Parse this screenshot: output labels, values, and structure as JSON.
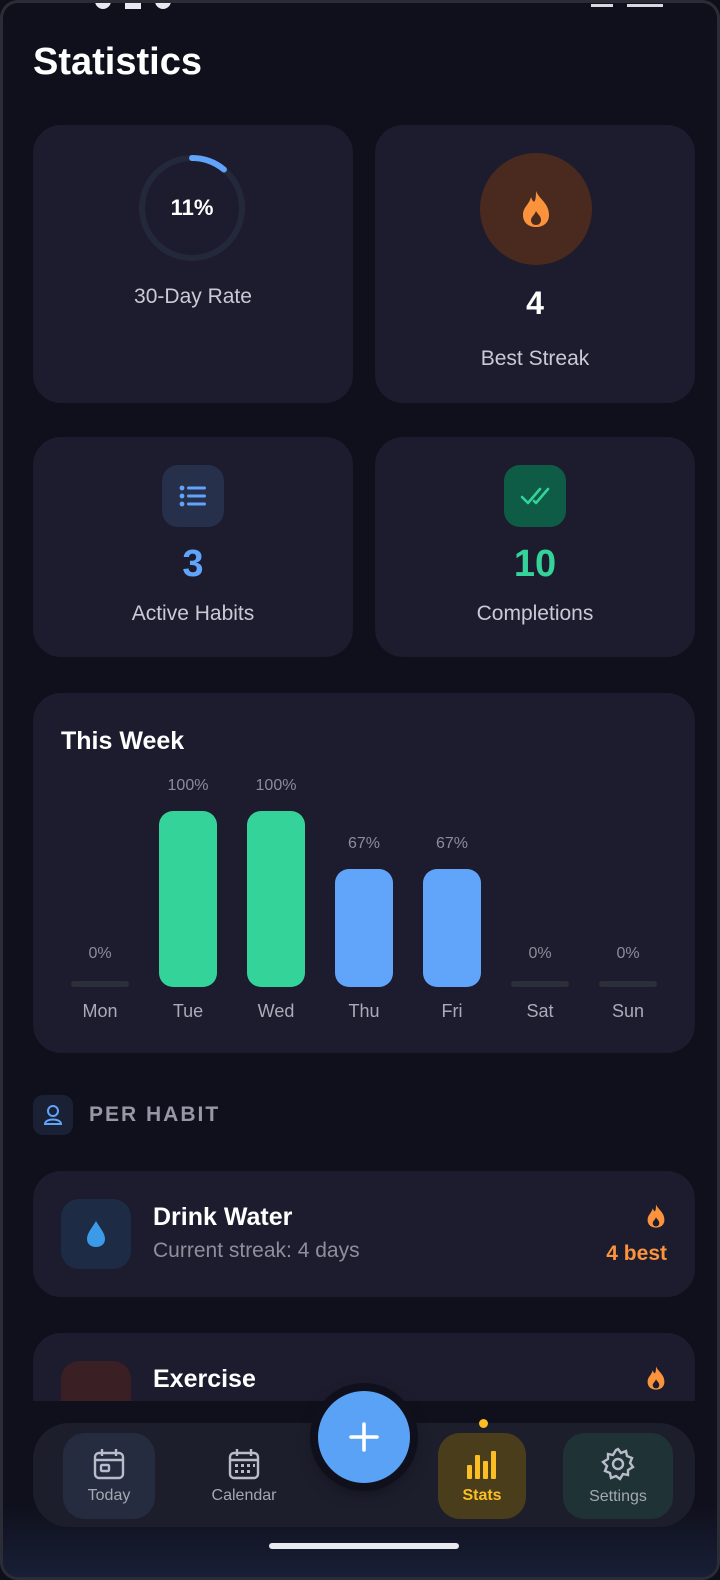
{
  "page": {
    "title": "Statistics"
  },
  "colors": {
    "background": "#10101c",
    "card": "#1c1c2e",
    "green": "#34d399",
    "blue": "#60a5fa",
    "orange": "#fb923c",
    "yellow": "#fbbf24"
  },
  "summary": {
    "rate": {
      "value": "11%",
      "fraction": 0.11,
      "label": "30-Day Rate"
    },
    "best_streak": {
      "value": "4",
      "label": "Best Streak",
      "icon": "flame-icon"
    },
    "active_habits": {
      "value": "3",
      "label": "Active Habits",
      "icon": "list-icon"
    },
    "completions": {
      "value": "10",
      "label": "Completions",
      "icon": "double-check-icon"
    }
  },
  "week": {
    "title": "This Week",
    "days": [
      {
        "day": "Mon",
        "pct": "0%",
        "value": 0
      },
      {
        "day": "Tue",
        "pct": "100%",
        "value": 100
      },
      {
        "day": "Wed",
        "pct": "100%",
        "value": 100
      },
      {
        "day": "Thu",
        "pct": "67%",
        "value": 67
      },
      {
        "day": "Fri",
        "pct": "67%",
        "value": 67
      },
      {
        "day": "Sat",
        "pct": "0%",
        "value": 0
      },
      {
        "day": "Sun",
        "pct": "0%",
        "value": 0
      }
    ]
  },
  "per_habit": {
    "label": "PER HABIT",
    "items": [
      {
        "name": "Drink Water",
        "sub": "Current streak: 4 days",
        "best": "4 best",
        "icon": "water-drop-icon"
      },
      {
        "name": "Exercise",
        "icon": "dumbbell-icon"
      }
    ]
  },
  "nav": {
    "today": "Today",
    "calendar": "Calendar",
    "stats": "Stats",
    "settings": "Settings",
    "fab": "add-icon"
  }
}
